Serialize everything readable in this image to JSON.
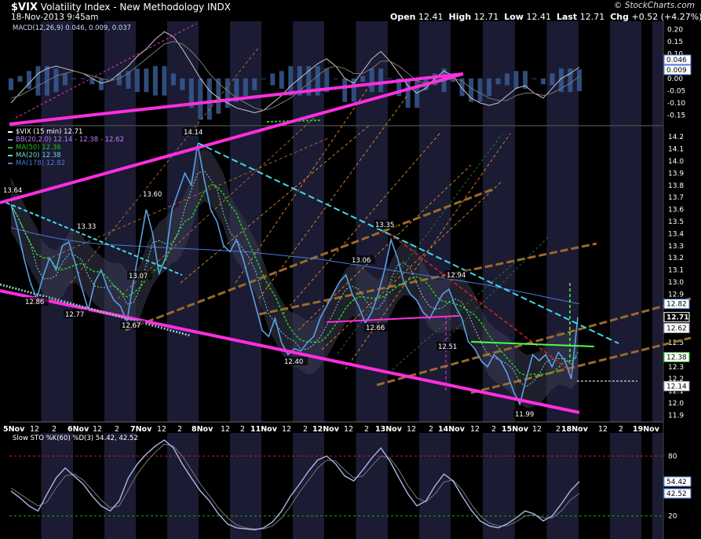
{
  "header": {
    "symbol": "$VIX",
    "name": "Volatility Index - New Methodology",
    "exchange": "INDX",
    "datetime": "18-Nov-2013 9:45am",
    "brand": "© StockCharts.com",
    "quote": {
      "open_label": "Open",
      "open": "12.41",
      "high_label": "High",
      "high": "12.71",
      "low_label": "Low",
      "low": "12.41",
      "last_label": "Last",
      "last": "12.71",
      "chg_label": "Chg",
      "chg": "+0.52 (+4.27%)"
    }
  },
  "colors": {
    "background": "#000000",
    "price": "#5aa0e6",
    "trendline_magenta": "#ff2ee0",
    "trendline_cyan": "#40d8e8",
    "ma50": "#1fc41f",
    "ma20": "#7fd4d4",
    "ma178": "#4a7ad8",
    "bollinger": "#9a9aa8",
    "red_line": "#e02020",
    "green_line": "#4cff4c",
    "orange_channel": "#e08a28",
    "brown_channel": "#9a6a2a",
    "grid_dark": "#1b1b33"
  },
  "chart_data": [
    {
      "type": "line",
      "panel": "macd",
      "legend": "MACD(12,26,9) 0.046, 0.009, 0.037",
      "y_ticks": [
        "0.20",
        "0.15",
        "0.10",
        "0.05",
        "0.00",
        "-0.05",
        "-0.10",
        "-0.15"
      ],
      "ylim": [
        -0.18,
        0.22
      ],
      "value_boxes": [
        "0.046",
        "0.009"
      ],
      "series": [
        {
          "legend_label": "MACD",
          "values": [
            -0.1,
            -0.06,
            -0.02,
            0.02,
            0.04,
            0.05,
            0.04,
            0.03,
            0.02,
            0.0,
            -0.02,
            -0.01,
            0.02,
            0.05,
            0.09,
            0.12,
            0.16,
            0.19,
            0.17,
            0.12,
            0.06,
            0.0,
            -0.05,
            -0.08,
            -0.1,
            -0.12,
            -0.13,
            -0.14,
            -0.13,
            -0.1,
            -0.07,
            -0.03,
            0.0,
            0.03,
            0.06,
            0.08,
            0.05,
            0.0,
            -0.02,
            0.03,
            0.08,
            0.11,
            0.07,
            0.02,
            -0.03,
            -0.06,
            -0.04,
            0.0,
            0.03,
            0.01,
            -0.04,
            -0.08,
            -0.1,
            -0.11,
            -0.1,
            -0.07,
            -0.04,
            -0.03,
            -0.06,
            -0.08,
            -0.04,
            0.0,
            0.02,
            0.046
          ]
        },
        {
          "legend_label": "Signal",
          "values": [
            -0.08,
            -0.07,
            -0.05,
            -0.03,
            -0.01,
            0.01,
            0.02,
            0.03,
            0.02,
            0.01,
            0.0,
            -0.01,
            0.0,
            0.02,
            0.05,
            0.08,
            0.11,
            0.14,
            0.15,
            0.14,
            0.11,
            0.07,
            0.02,
            -0.02,
            -0.05,
            -0.08,
            -0.1,
            -0.12,
            -0.13,
            -0.12,
            -0.1,
            -0.08,
            -0.05,
            -0.02,
            0.01,
            0.04,
            0.05,
            0.04,
            0.02,
            0.02,
            0.04,
            0.07,
            0.07,
            0.05,
            0.02,
            -0.01,
            -0.02,
            -0.02,
            -0.01,
            0.0,
            -0.01,
            -0.04,
            -0.06,
            -0.08,
            -0.09,
            -0.09,
            -0.07,
            -0.06,
            -0.06,
            -0.07,
            -0.06,
            -0.04,
            -0.02,
            0.009
          ]
        }
      ]
    },
    {
      "type": "line",
      "panel": "price",
      "legend": [
        "$VIX (15 min) 12.71",
        "BB(20,2.0) 12.14 - 12.38 - 12.62",
        "MA(50) 12.36",
        "MA(20) 12.38",
        "MA(178) 12.82"
      ],
      "y_ticks": [
        "14.2",
        "14.1",
        "14.0",
        "13.9",
        "13.8",
        "13.7",
        "13.6",
        "13.5",
        "13.4",
        "13.3",
        "13.2",
        "13.1",
        "13.0",
        "12.9",
        "12.8",
        "12.7",
        "12.6",
        "12.5",
        "12.4",
        "12.3",
        "12.2",
        "12.1",
        "12.0",
        "11.9"
      ],
      "ylim": [
        11.87,
        14.26
      ],
      "x_ticks": [
        "5Nov",
        "12",
        "2",
        "6Nov",
        "12",
        "2",
        "7Nov",
        "12",
        "2",
        "8Nov",
        "12",
        "2",
        "11Nov",
        "12",
        "2",
        "12Nov",
        "12",
        "2",
        "13Nov",
        "12",
        "2",
        "14Nov",
        "12",
        "2",
        "15Nov",
        "12",
        "2",
        "18Nov",
        "12",
        "2",
        "19Nov"
      ],
      "annotations": [
        "13.64",
        "12.86",
        "13.33",
        "12.77",
        "13.60",
        "13.07",
        "12.67",
        "14.14",
        "12.40",
        "13.06",
        "12.66",
        "13.35",
        "12.94",
        "12.51",
        "11.99"
      ],
      "value_boxes": [
        "12.82",
        "12.71",
        "12.62",
        "12.38",
        "12.14"
      ],
      "series": [
        {
          "legend_label": "$VIX",
          "values": [
            13.64,
            13.45,
            13.2,
            13.0,
            12.86,
            13.05,
            13.2,
            13.1,
            13.3,
            13.33,
            13.15,
            12.95,
            12.77,
            13.0,
            13.1,
            12.95,
            12.85,
            12.8,
            12.67,
            13.0,
            13.3,
            13.6,
            13.4,
            13.07,
            13.2,
            13.6,
            13.75,
            13.9,
            13.8,
            14.14,
            13.85,
            13.6,
            13.5,
            13.3,
            13.25,
            13.35,
            13.2,
            13.0,
            12.8,
            12.6,
            12.55,
            12.7,
            12.5,
            12.4,
            12.45,
            12.43,
            12.5,
            12.55,
            12.7,
            12.8,
            12.9,
            13.0,
            13.06,
            12.9,
            12.8,
            12.66,
            12.75,
            12.9,
            13.1,
            13.35,
            13.2,
            13.0,
            12.9,
            12.85,
            12.75,
            12.7,
            12.8,
            12.9,
            12.94,
            12.8,
            12.7,
            12.51,
            12.45,
            12.35,
            12.3,
            12.4,
            12.35,
            12.25,
            12.1,
            11.99,
            12.2,
            12.4,
            12.35,
            12.4,
            12.3,
            12.42,
            12.35,
            12.2,
            12.71
          ]
        },
        {
          "legend_label": "MA(178)",
          "values": [
            13.45,
            13.4,
            13.36,
            13.33,
            13.31,
            13.3,
            13.29,
            13.28,
            13.27,
            13.26,
            13.25,
            13.23,
            13.21,
            13.19,
            13.16,
            13.13,
            13.1,
            13.07,
            13.04,
            13.01,
            12.98,
            12.94,
            12.9,
            12.86,
            12.82
          ]
        }
      ]
    },
    {
      "type": "line",
      "panel": "stochastic",
      "legend": "Slow STO %K(60) %D(3) 54.42, 42.52",
      "y_ticks": [
        "80",
        "20"
      ],
      "ylim": [
        0,
        100
      ],
      "value_boxes": [
        "54.42",
        "42.52"
      ],
      "series": [
        {
          "legend_label": "%K",
          "values": [
            45,
            38,
            30,
            25,
            42,
            58,
            68,
            60,
            52,
            40,
            30,
            25,
            35,
            58,
            72,
            82,
            90,
            96,
            88,
            72,
            58,
            45,
            35,
            22,
            12,
            8,
            7,
            6,
            8,
            14,
            25,
            40,
            52,
            65,
            76,
            80,
            72,
            60,
            55,
            66,
            78,
            88,
            75,
            58,
            42,
            30,
            35,
            50,
            62,
            55,
            40,
            26,
            15,
            10,
            8,
            12,
            18,
            25,
            22,
            15,
            20,
            32,
            45,
            54.42
          ]
        },
        {
          "legend_label": "%D",
          "values": [
            48,
            42,
            36,
            30,
            34,
            48,
            60,
            62,
            56,
            46,
            36,
            28,
            30,
            46,
            62,
            74,
            84,
            92,
            90,
            80,
            66,
            52,
            40,
            28,
            18,
            11,
            8,
            7,
            7,
            10,
            18,
            30,
            44,
            56,
            68,
            76,
            75,
            66,
            58,
            60,
            70,
            80,
            78,
            66,
            50,
            38,
            34,
            42,
            54,
            56,
            46,
            32,
            20,
            13,
            10,
            10,
            14,
            20,
            21,
            18,
            18,
            25,
            36,
            42.52
          ]
        }
      ]
    }
  ]
}
